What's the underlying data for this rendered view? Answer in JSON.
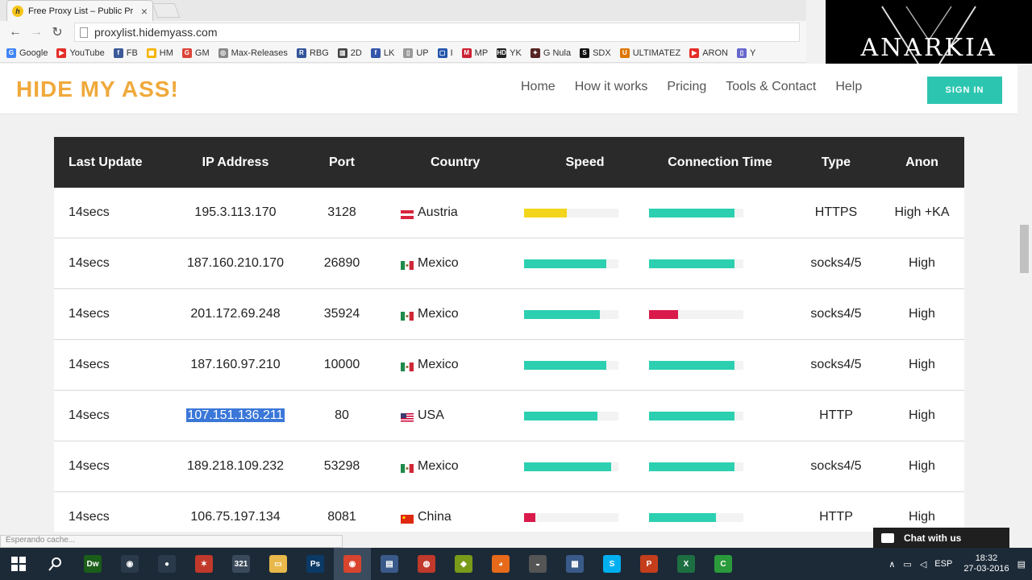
{
  "browser": {
    "tab_title": "Free Proxy List – Public Pr",
    "favicon_letter": "h",
    "url": "proxylist.hidemyass.com",
    "bookmarks": [
      {
        "label": "Google",
        "color": "#4285f4",
        "icon": "G"
      },
      {
        "label": "YouTube",
        "color": "#e52d27",
        "icon": "▶"
      },
      {
        "label": "FB",
        "color": "#3b5998",
        "icon": "f"
      },
      {
        "label": "HM",
        "color": "#f4b400",
        "icon": "▦"
      },
      {
        "label": "GM",
        "color": "#db4437",
        "icon": "G"
      },
      {
        "label": "Max-Releases",
        "color": "#888888",
        "icon": "◎"
      },
      {
        "label": "RBG",
        "color": "#335599",
        "icon": "R"
      },
      {
        "label": "2D",
        "color": "#444444",
        "icon": "▥"
      },
      {
        "label": "LK",
        "color": "#3355aa",
        "icon": "f"
      },
      {
        "label": "UP",
        "color": "#999999",
        "icon": "▯"
      },
      {
        "label": "I",
        "color": "#2255aa",
        "icon": "▢"
      },
      {
        "label": "MP",
        "color": "#cc2233",
        "icon": "M"
      },
      {
        "label": "YK",
        "color": "#222222",
        "icon": "HD"
      },
      {
        "label": "G Nula",
        "color": "#552222",
        "icon": "✦"
      },
      {
        "label": "SDX",
        "color": "#111111",
        "icon": "S"
      },
      {
        "label": "ULTIMATEZ",
        "color": "#dd7700",
        "icon": "U"
      },
      {
        "label": "ARON",
        "color": "#e52d27",
        "icon": "▶"
      },
      {
        "label": "Y",
        "color": "#6666cc",
        "icon": "▯"
      }
    ]
  },
  "overlay": {
    "logo_text": "ANARKIA"
  },
  "site": {
    "logo": "HIDE MY ASS!",
    "nav": [
      "Home",
      "How it works",
      "Pricing",
      "Tools & Contact",
      "Help"
    ],
    "signin": "SIGN IN"
  },
  "table": {
    "headers": [
      "Last Update",
      "IP Address",
      "Port",
      "Country",
      "Speed",
      "Connection Time",
      "Type",
      "Anon"
    ],
    "rows": [
      {
        "last": "14secs",
        "ip": "195.3.113.170",
        "port": "3128",
        "country": "Austria",
        "flag": "austria",
        "speed": 0.45,
        "speed_color": "#f2d51c",
        "conn": 0.91,
        "conn_color": "#2cd0b0",
        "type": "HTTPS",
        "anon": "High +KA"
      },
      {
        "last": "14secs",
        "ip": "187.160.210.170",
        "port": "26890",
        "country": "Mexico",
        "flag": "mexico",
        "speed": 0.87,
        "speed_color": "#2cd0b0",
        "conn": 0.91,
        "conn_color": "#2cd0b0",
        "type": "socks4/5",
        "anon": "High"
      },
      {
        "last": "14secs",
        "ip": "201.172.69.248",
        "port": "35924",
        "country": "Mexico",
        "flag": "mexico",
        "speed": 0.8,
        "speed_color": "#2cd0b0",
        "conn": 0.31,
        "conn_color": "#d91a4a",
        "type": "socks4/5",
        "anon": "High"
      },
      {
        "last": "14secs",
        "ip": "187.160.97.210",
        "port": "10000",
        "country": "Mexico",
        "flag": "mexico",
        "speed": 0.87,
        "speed_color": "#2cd0b0",
        "conn": 0.91,
        "conn_color": "#2cd0b0",
        "type": "socks4/5",
        "anon": "High"
      },
      {
        "last": "14secs",
        "ip": "107.151.136.211",
        "port": "80",
        "country": "USA",
        "flag": "usa",
        "speed": 0.78,
        "speed_color": "#2cd0b0",
        "conn": 0.91,
        "conn_color": "#2cd0b0",
        "type": "HTTP",
        "anon": "High",
        "selected": true
      },
      {
        "last": "14secs",
        "ip": "189.218.109.232",
        "port": "53298",
        "country": "Mexico",
        "flag": "mexico",
        "speed": 0.92,
        "speed_color": "#2cd0b0",
        "conn": 0.91,
        "conn_color": "#2cd0b0",
        "type": "socks4/5",
        "anon": "High"
      },
      {
        "last": "14secs",
        "ip": "106.75.197.134",
        "port": "8081",
        "country": "China",
        "flag": "china",
        "speed": 0.12,
        "speed_color": "#d91a4a",
        "conn": 0.71,
        "conn_color": "#2cd0b0",
        "type": "HTTP",
        "anon": "High"
      }
    ]
  },
  "status": "Esperando cache...",
  "chat": "Chat with us",
  "taskbar": {
    "apps": [
      {
        "name": "dreamweaver",
        "label": "Dw",
        "color": "#1a5e1a"
      },
      {
        "name": "app-2",
        "label": "◉",
        "color": "#2a3a4a"
      },
      {
        "name": "app-3",
        "label": "●",
        "color": "#2a3a4a"
      },
      {
        "name": "app-4",
        "label": "✶",
        "color": "#c0392b"
      },
      {
        "name": "app-5",
        "label": "321",
        "color": "#3a4a5a"
      },
      {
        "name": "file-explorer",
        "label": "▭",
        "color": "#e8b84a"
      },
      {
        "name": "photoshop",
        "label": "Ps",
        "color": "#0b3a66"
      },
      {
        "name": "chrome",
        "label": "◉",
        "color": "#d9442e"
      },
      {
        "name": "app-9",
        "label": "▤",
        "color": "#3a5a8a"
      },
      {
        "name": "app-10",
        "label": "◍",
        "color": "#c0392b"
      },
      {
        "name": "app-11",
        "label": "◆",
        "color": "#7a9a1a"
      },
      {
        "name": "firefox",
        "label": "◕",
        "color": "#e66a1a"
      },
      {
        "name": "app-13",
        "label": "◒",
        "color": "#555555"
      },
      {
        "name": "app-14",
        "label": "▦",
        "color": "#3a5a8a"
      },
      {
        "name": "skype",
        "label": "S",
        "color": "#00aff0"
      },
      {
        "name": "powerpoint",
        "label": "P",
        "color": "#c43e1c"
      },
      {
        "name": "excel",
        "label": "X",
        "color": "#1d6f42"
      },
      {
        "name": "camtasia",
        "label": "C",
        "color": "#2a9a3a"
      }
    ],
    "lang": "ESP",
    "time": "18:32",
    "date": "27-03-2016"
  }
}
